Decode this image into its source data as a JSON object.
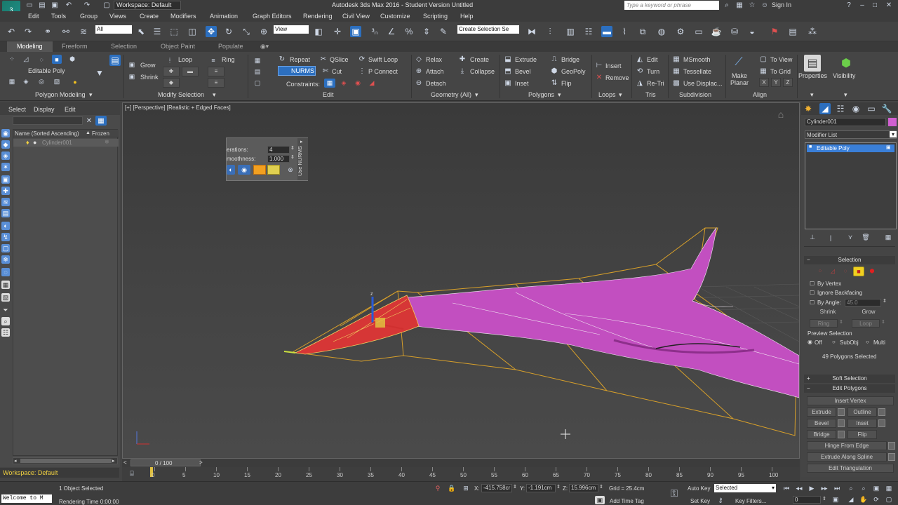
{
  "titlebar": {
    "workspace": "Workspace: Default",
    "title": "Autodesk 3ds Max 2016 - Student Version   Untitled",
    "search_placeholder": "Type a keyword or phrase",
    "sign_in": "Sign In"
  },
  "menu": [
    "Edit",
    "Tools",
    "Group",
    "Views",
    "Create",
    "Modifiers",
    "Animation",
    "Graph Editors",
    "Rendering",
    "Civil View",
    "Customize",
    "Scripting",
    "Help"
  ],
  "toolbar": {
    "filter": "All",
    "view": "View",
    "selection_set": "Create Selection Se"
  },
  "ribbon_tabs": [
    "Modeling",
    "Freeform",
    "Selection",
    "Object Paint",
    "Populate"
  ],
  "ribbon": {
    "editable_poly": "Editable Poly",
    "polygon_modeling": "Polygon Modeling",
    "grow": "Grow",
    "shrink": "Shrink",
    "loop": "Loop",
    "ring": "Ring",
    "modify_selection": "Modify Selection",
    "repeat": "Repeat",
    "qslice": "QSlice",
    "swift_loop": "Swift Loop",
    "nurms": "NURMS",
    "cut": "Cut",
    "p_connect": "P Connect",
    "constraints": "Constraints:",
    "edit": "Edit",
    "relax": "Relax",
    "create": "Create",
    "attach": "Attach",
    "collapse": "Collapse",
    "detach": "Detach",
    "geometry_all": "Geometry (All)",
    "extrude": "Extrude",
    "bridge": "Bridge",
    "bevel": "Bevel",
    "geopoly": "GeoPoly",
    "inset": "Inset",
    "flip": "Flip",
    "polygons": "Polygons",
    "insert": "Insert",
    "remove": "Remove",
    "loops": "Loops",
    "tris_edit": "Edit",
    "turn": "Turn",
    "re_tri": "Re-Tri",
    "tris": "Tris",
    "msmooth": "MSmooth",
    "tessellate": "Tessellate",
    "use_displac": "Use Displac...",
    "subdivision": "Subdivision",
    "make_planar": "Make Planar",
    "to_view": "To View",
    "to_grid": "To Grid",
    "x": "X",
    "y": "Y",
    "z": "Z",
    "align": "Align",
    "properties": "Properties",
    "visibility": "Visibility"
  },
  "explorer": {
    "tabs": [
      "Select",
      "Display",
      "Edit"
    ],
    "col_name": "Name (Sorted Ascending)",
    "col_frozen": "Frozen",
    "item": "Cylinder001"
  },
  "viewport": {
    "label": "[+] [Perspective] [Realistic + Edged Faces]"
  },
  "caddy": {
    "iterations_label": "erations:",
    "iterations": "4",
    "smoothness_label": "moothness:",
    "smoothness": "1.000",
    "use_nurms": "Use NURMS"
  },
  "right": {
    "object_name": "Cylinder001",
    "modifier_list": "Modifier List",
    "stack_item": "Editable Poly",
    "selection": "Selection",
    "by_vertex": "By Vertex",
    "ignore_backfacing": "Ignore Backfacing",
    "by_angle": "By Angle:",
    "angle": "45.0",
    "shrink": "Shrink",
    "grow": "Grow",
    "ring": "Ring",
    "loop": "Loop",
    "preview_selection": "Preview Selection",
    "off": "Off",
    "subobj": "SubObj",
    "multi": "Multi",
    "polys_selected": "49 Polygons Selected",
    "soft_selection": "Soft Selection",
    "edit_polygons": "Edit Polygons",
    "insert_vertex": "Insert Vertex",
    "extrude": "Extrude",
    "outline": "Outline",
    "bevel": "Bevel",
    "inset": "Inset",
    "bridge": "Bridge",
    "flip": "Flip",
    "hinge": "Hinge From Edge",
    "extrude_spline": "Extrude Along Spline",
    "edit_tri": "Edit Triangulation"
  },
  "timeline": {
    "frame": "0 / 100",
    "ticks": [
      "0",
      "5",
      "10",
      "15",
      "20",
      "25",
      "30",
      "35",
      "40",
      "45",
      "50",
      "55",
      "60",
      "65",
      "70",
      "75",
      "80",
      "85",
      "90",
      "95",
      "100"
    ]
  },
  "status": {
    "workspace": "Workspace: Default",
    "welcome": "Welcome to M",
    "objects": "1 Object Selected",
    "render_time": "Rendering Time  0:00:00",
    "x_label": "X:",
    "x": "-415.758cr",
    "y_label": "Y:",
    "y": "-1.191cm",
    "z_label": "Z:",
    "z": "15.996cm",
    "grid": "Grid = 25.4cm",
    "auto_key": "Auto Key",
    "selected": "Selected",
    "set_key": "Set Key",
    "key_filters": "Key Filters...",
    "add_time_tag": "Add Time Tag",
    "frame": "0"
  }
}
